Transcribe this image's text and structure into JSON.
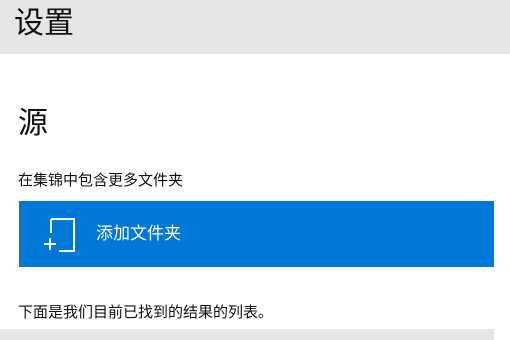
{
  "header": {
    "title": "设置"
  },
  "section": {
    "title": "源",
    "description": "在集锦中包含更多文件夹"
  },
  "add_folder_button": {
    "label": "添加文件夹",
    "icon": "add-folder-icon",
    "background_color": "#0078d7",
    "text_color": "#ffffff"
  },
  "results": {
    "description": "下面是我们目前已找到的结果的列表。"
  },
  "colors": {
    "header_background": "#e6e6e6",
    "page_background": "#ffffff"
  }
}
